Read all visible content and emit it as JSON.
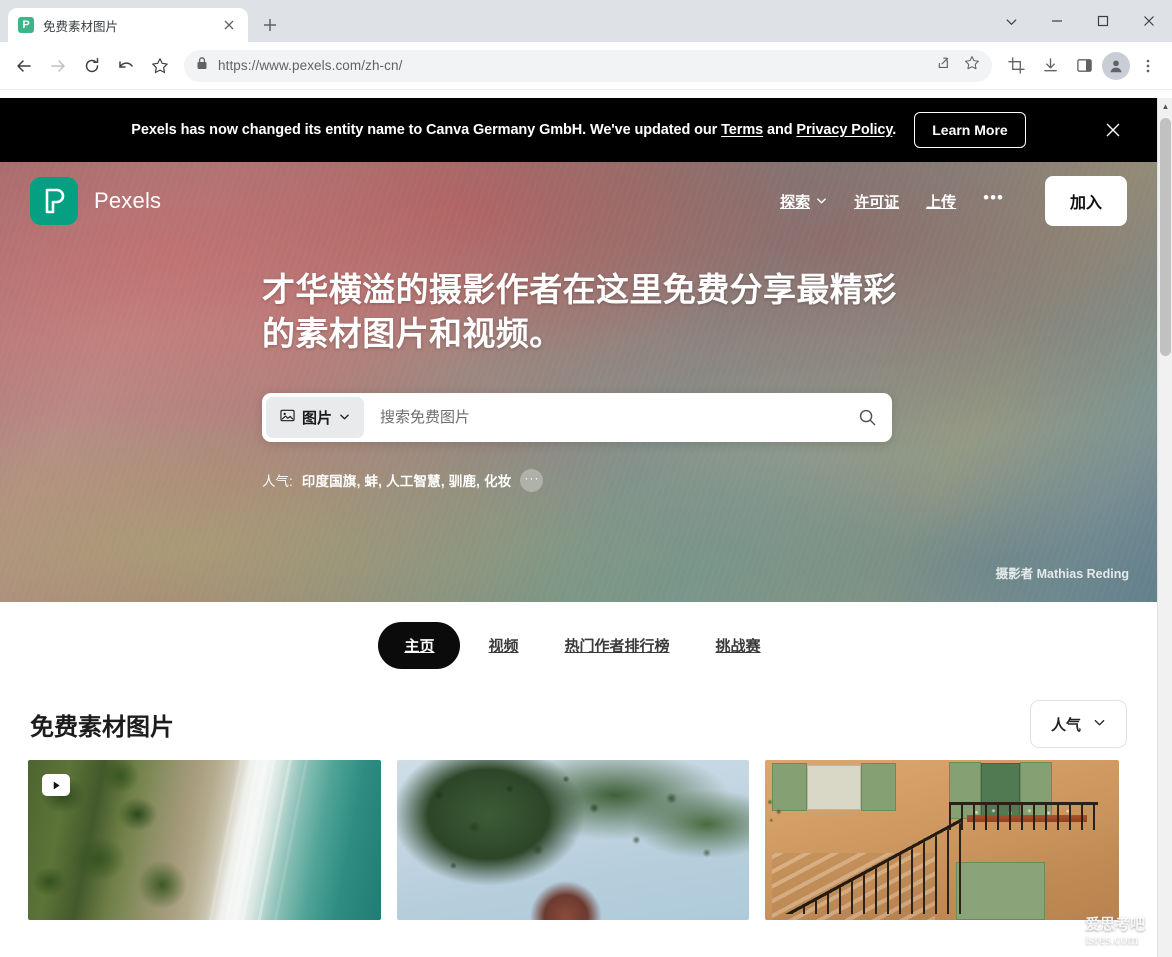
{
  "browser": {
    "tab": {
      "title": "免费素材图片",
      "favicon_letter": "P",
      "close_icon": "close-icon"
    },
    "new_tab_label": "+",
    "window": {
      "minimize": "–",
      "maximize": "□",
      "close": "✕",
      "dropdown": "⌄"
    },
    "toolbar": {
      "back_icon": "back-arrow-icon",
      "forward_icon": "forward-arrow-icon",
      "reload_icon": "reload-icon",
      "undo_icon": "undo-arrow-icon",
      "bookmark_star_icon": "star-icon",
      "lock_icon": "lock-icon",
      "url": "https://www.pexels.com/zh-cn/",
      "share_icon": "share-icon",
      "favorite_icon": "star-outline-icon",
      "screenshot_icon": "crop-icon",
      "download_icon": "download-icon",
      "sidepanel_icon": "side-panel-icon",
      "profile_icon": "profile-avatar-icon",
      "menu_icon": "three-dot-menu-icon"
    }
  },
  "notice": {
    "text_before_terms": "Pexels has now changed its entity name to Canva Germany GmbH. We've updated our ",
    "terms_link": "Terms",
    "text_between": " and ",
    "privacy_link": "Privacy Policy",
    "text_after": ".",
    "learn_more": "Learn More",
    "close_icon": "close-icon"
  },
  "header": {
    "brand": "Pexels",
    "logo_color": "#05A081",
    "nav": [
      {
        "label": "探索",
        "has_chevron": true
      },
      {
        "label": "许可证",
        "has_chevron": false
      },
      {
        "label": "上传",
        "has_chevron": false
      }
    ],
    "more_icon": "ellipsis-icon",
    "join_button": "加入"
  },
  "hero": {
    "title_line1": "才华横溢的摄影作者在这里免费分享最精彩",
    "title_line2": "的素材图片和视频。",
    "search": {
      "type_label": "图片",
      "type_icon": "image-icon",
      "chevron_icon": "chevron-down-icon",
      "placeholder": "搜索免费图片",
      "value": "",
      "search_icon": "search-icon"
    },
    "popular": {
      "label": "人气:",
      "tags": "印度国旗, 蚌, 人工智慧, 驯鹿, 化妆",
      "more": "···"
    },
    "credit": "摄影者 Mathias Reding"
  },
  "content_tabs": [
    {
      "label": "主页",
      "active": true
    },
    {
      "label": "视频",
      "active": false
    },
    {
      "label": "热门作者排行榜",
      "active": false
    },
    {
      "label": "挑战赛",
      "active": false
    }
  ],
  "section": {
    "title": "免费素材图片",
    "sort": {
      "label": "人气",
      "chevron_icon": "chevron-down-icon"
    }
  },
  "grid": [
    {
      "alt": "aerial coastline with waves",
      "is_video": true,
      "play_icon": "play-icon"
    },
    {
      "alt": "woman smiling under pine tree",
      "is_video": false
    },
    {
      "alt": "ochre wall with iron staircase and green shutters",
      "is_video": false
    }
  ],
  "watermark": {
    "line1": "爱思考吧",
    "line2": "isres.com"
  },
  "scrollbar": {
    "up_icon": "scroll-up-arrow",
    "down_icon": "scroll-down-arrow"
  }
}
